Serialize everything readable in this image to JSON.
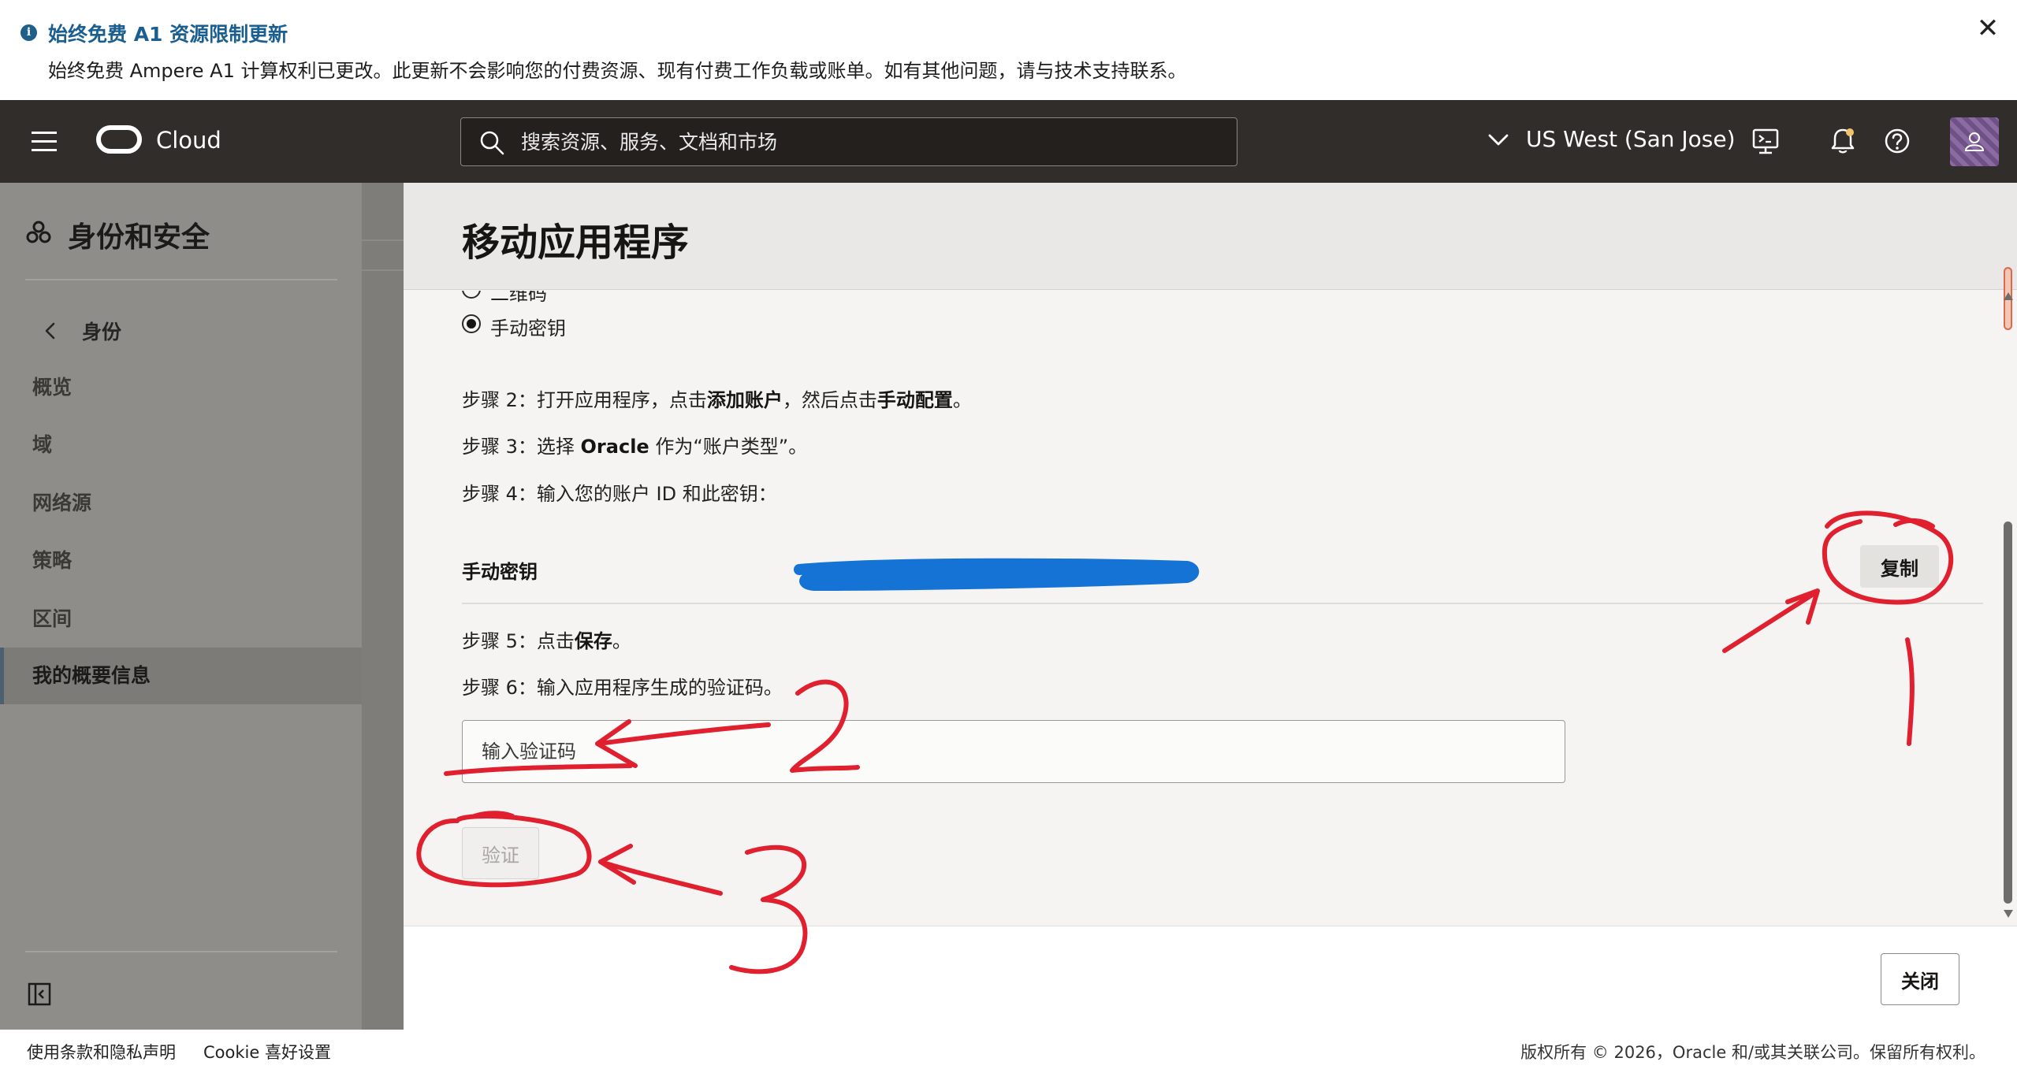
{
  "banner": {
    "title": "始终免费 A1 资源限制更新",
    "text": "始终免费 Ampere A1 计算权利已更改。此更新不会影响您的付费资源、现有付费工作负载或账单。如有其他问题，请与技术支持联系。",
    "info_icon": "i",
    "close_icon": "✕"
  },
  "topnav": {
    "brand": "Cloud",
    "search_placeholder": "搜索资源、服务、文档和市场",
    "region": "US West (San Jose)"
  },
  "sidebar": {
    "title": "身份和安全",
    "back_label": "身份",
    "items": [
      "概览",
      "域",
      "网络源",
      "策略",
      "区间",
      "我的概要信息"
    ],
    "active_index": 5
  },
  "panel": {
    "title": "移动应用程序",
    "radio_partial": "二维码",
    "radio_manual": "手动密钥",
    "step2": {
      "prefix": "步骤 2：打开应用程序，点击",
      "b1": "添加账户",
      "mid": "，然后点击",
      "b2": "手动配置",
      "suffix": "。"
    },
    "step3": {
      "prefix": "步骤 3：选择 ",
      "b1": "Oracle",
      "suffix": " 作为“账户类型”。"
    },
    "step4": "步骤 4：输入您的账户 ID 和此密钥：",
    "key_label": "手动密钥",
    "copy_label": "复制",
    "step5": {
      "prefix": "步骤 5：点击",
      "b1": "保存",
      "suffix": "。"
    },
    "step6": "步骤 6：输入应用程序生成的验证码。",
    "code_placeholder": "输入验证码",
    "verify_label": "验证",
    "close_label": "关闭"
  },
  "footer": {
    "terms": "使用条款和隐私声明",
    "cookie": "Cookie 喜好设置",
    "copyright": "版权所有 © 2026，Oracle 和/或其关联公司。保留所有权利。"
  },
  "colors": {
    "nav_bg": "#312d2a",
    "banner_title": "#1a5f8f",
    "annotation_red": "#e0202e",
    "redaction_blue": "#1573d6"
  }
}
